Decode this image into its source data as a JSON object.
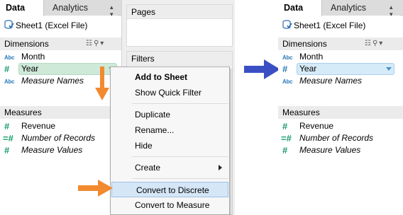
{
  "left_pane": {
    "tabs": [
      {
        "label": "Data",
        "active": true
      },
      {
        "label": "Analytics",
        "active": false
      }
    ],
    "datasource": "Sheet1 (Excel File)",
    "dimensions_header": "Dimensions",
    "dimensions": [
      {
        "icon": "Abc",
        "label": "Month"
      },
      {
        "icon": "#",
        "label": "Year",
        "selected": true
      },
      {
        "icon": "Abc",
        "label": "Measure Names"
      }
    ],
    "measures_header": "Measures",
    "measures": [
      {
        "icon": "#",
        "label": "Revenue"
      },
      {
        "icon": "=#",
        "label": "Number of Records"
      },
      {
        "icon": "#",
        "label": "Measure Values"
      }
    ]
  },
  "shelves": {
    "pages_label": "Pages",
    "filters_label": "Filters"
  },
  "context_menu": {
    "items": [
      {
        "label": "Add to Sheet",
        "bold": true
      },
      {
        "label": "Show Quick Filter"
      },
      {
        "label": "Duplicate"
      },
      {
        "label": "Rename..."
      },
      {
        "label": "Hide"
      },
      {
        "label": "Create",
        "submenu": true
      },
      {
        "label": "Convert to Discrete",
        "highlighted": true
      },
      {
        "label": "Convert to Measure"
      }
    ]
  },
  "right_pane": {
    "tabs": [
      {
        "label": "Data",
        "active": true
      },
      {
        "label": "Analytics",
        "active": false
      }
    ],
    "datasource": "Sheet1 (Excel File)",
    "dimensions_header": "Dimensions",
    "dimensions": [
      {
        "icon": "Abc",
        "label": "Month"
      },
      {
        "icon": "#",
        "label": "Year",
        "selected": true
      },
      {
        "icon": "Abc",
        "label": "Measure Names"
      }
    ],
    "measures_header": "Measures",
    "measures": [
      {
        "icon": "#",
        "label": "Revenue"
      },
      {
        "icon": "=#",
        "label": "Number of Records"
      },
      {
        "icon": "#",
        "label": "Measure Values"
      }
    ]
  },
  "colors": {
    "continuous_pill": "#cfe9d9",
    "discrete_pill": "#d6ebf8",
    "orange_arrow": "#f28a30",
    "blue_arrow": "#3a4fc4",
    "menu_highlight": "#d5e6f6"
  }
}
